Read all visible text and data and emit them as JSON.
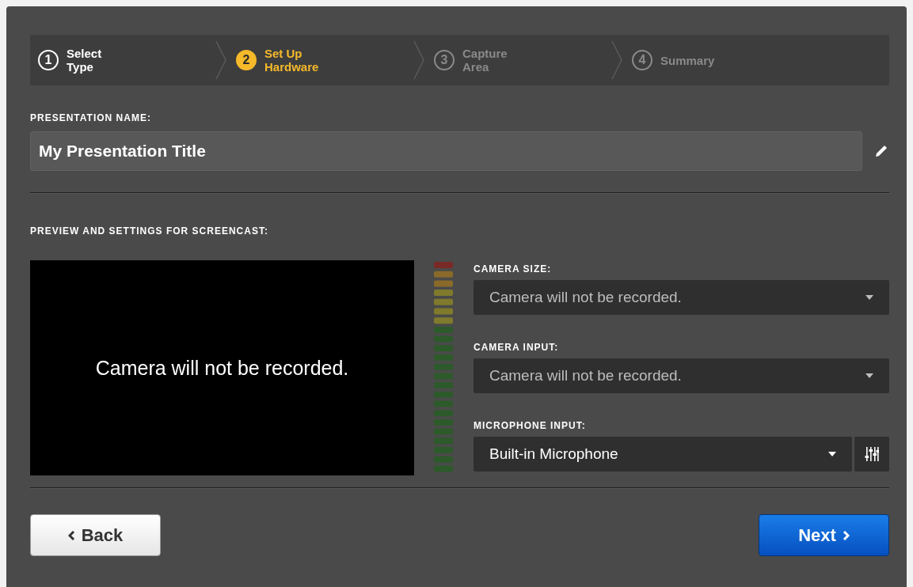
{
  "steps": [
    {
      "number": "1",
      "label": "Select\nType",
      "selected": false,
      "completed": true
    },
    {
      "number": "2",
      "label": "Set Up\nHardware",
      "selected": true,
      "completed": false
    },
    {
      "number": "3",
      "label": "Capture\nArea",
      "selected": false,
      "completed": false
    },
    {
      "number": "4",
      "label": "Summary",
      "selected": false,
      "completed": false
    }
  ],
  "presentation_name": {
    "label": "PRESENTATION NAME:",
    "value": "My Presentation Title"
  },
  "preview": {
    "heading": "PREVIEW AND SETTINGS FOR SCREENCAST:",
    "message": "Camera will not be recorded."
  },
  "settings": [
    {
      "label": "CAMERA SIZE:",
      "value": "Camera will not be recorded.",
      "disabled": true,
      "kind": "select"
    },
    {
      "label": "CAMERA INPUT:",
      "value": "Camera will not be recorded.",
      "disabled": true,
      "kind": "select"
    },
    {
      "label": "MICROPHONE INPUT:",
      "value": "Built-in Microphone",
      "disabled": false,
      "kind": "select-with-mixer"
    }
  ],
  "buttons": [
    {
      "label": "Back",
      "kind": "back"
    },
    {
      "label": "Next",
      "kind": "next"
    }
  ]
}
